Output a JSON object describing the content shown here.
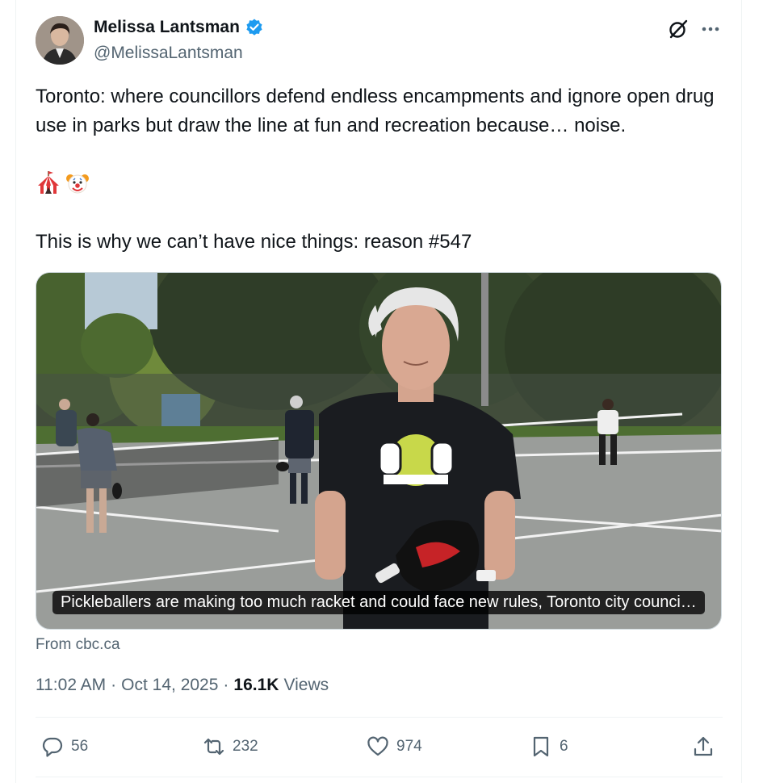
{
  "author": {
    "display_name": "Melissa Lantsman",
    "handle": "@MelissaLantsman",
    "verified": true
  },
  "post": {
    "text": "Toronto: where councillors defend endless encampments and ignore open drug use in parks but draw the line at fun and recreation because… noise.",
    "emojis": [
      "circus-tent",
      "clown-face"
    ],
    "text_after": "This is why we can’t have nice things: reason #547"
  },
  "media": {
    "caption": "Pickleballers are making too much racket and could face new rules, Toronto city counci…",
    "source": "From cbc.ca"
  },
  "meta": {
    "time": "11:02 AM",
    "date": "Oct 14, 2025",
    "views_count": "16.1K",
    "views_label": "Views",
    "separator": "·"
  },
  "actions": {
    "replies": "56",
    "reposts": "232",
    "likes": "974",
    "bookmarks": "6"
  },
  "colors": {
    "text": "#0f1419",
    "secondary": "#536471",
    "verified": "#1d9bf0",
    "divider": "#eff3f4"
  },
  "icons": [
    "grok-icon",
    "more-icon",
    "reply-icon",
    "repost-icon",
    "like-icon",
    "bookmark-icon",
    "share-icon",
    "verified-badge-icon"
  ]
}
